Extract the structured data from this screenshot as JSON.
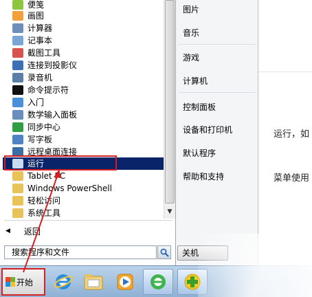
{
  "programs": [
    {
      "label": "便笺",
      "icon": "sticky-notes-icon",
      "color": "#8cc63f"
    },
    {
      "label": "画图",
      "icon": "paint-icon",
      "color": "#f2a03d"
    },
    {
      "label": "计算器",
      "icon": "calculator-icon",
      "color": "#6b8fb8"
    },
    {
      "label": "记事本",
      "icon": "notepad-icon",
      "color": "#7aa6d6"
    },
    {
      "label": "截图工具",
      "icon": "snipping-tool-icon",
      "color": "#d9534f"
    },
    {
      "label": "连接到投影仪",
      "icon": "projector-icon",
      "color": "#3d6fb4"
    },
    {
      "label": "录音机",
      "icon": "microphone-icon",
      "color": "#5b7fa8"
    },
    {
      "label": "命令提示符",
      "icon": "command-prompt-icon",
      "color": "#111111"
    },
    {
      "label": "入门",
      "icon": "getting-started-icon",
      "color": "#4a90d9"
    },
    {
      "label": "数学输入面板",
      "icon": "math-panel-icon",
      "color": "#6a8fbf"
    },
    {
      "label": "同步中心",
      "icon": "sync-center-icon",
      "color": "#2f9e44"
    },
    {
      "label": "写字板",
      "icon": "wordpad-icon",
      "color": "#4f84c4"
    },
    {
      "label": "远程桌面连接",
      "icon": "remote-desktop-icon",
      "color": "#3a6ea5"
    },
    {
      "label": "运行",
      "icon": "run-icon",
      "color": "#c9dcf2"
    },
    {
      "label": "Tablet PC",
      "icon": "folder-icon",
      "color": "#e8c35a"
    },
    {
      "label": "Windows PowerShell",
      "icon": "folder-icon",
      "color": "#e8c35a"
    },
    {
      "label": "轻松访问",
      "icon": "folder-icon",
      "color": "#e8c35a"
    },
    {
      "label": "系统工具",
      "icon": "folder-icon",
      "color": "#e8c35a"
    }
  ],
  "selected_program": "运行",
  "back_label": "返回",
  "search_placeholder": "搜索程序和文件",
  "right_items": [
    {
      "label": "图片"
    },
    {
      "label": "音乐"
    },
    {
      "label": "游戏"
    },
    {
      "label": "计算机"
    },
    {
      "label": "控制面板"
    },
    {
      "label": "设备和打印机"
    },
    {
      "label": "默认程序"
    },
    {
      "label": "帮助和支持"
    }
  ],
  "shutdown_label": "关机",
  "start_label": "开始",
  "taskbar_apps": [
    {
      "icon": "internet-explorer-icon"
    },
    {
      "icon": "file-explorer-icon"
    },
    {
      "icon": "media-player-icon"
    },
    {
      "icon": "ie-update-icon"
    },
    {
      "icon": "app-plus-icon"
    }
  ],
  "background_text": {
    "line1": "运行，如",
    "line2": "菜单使用"
  }
}
